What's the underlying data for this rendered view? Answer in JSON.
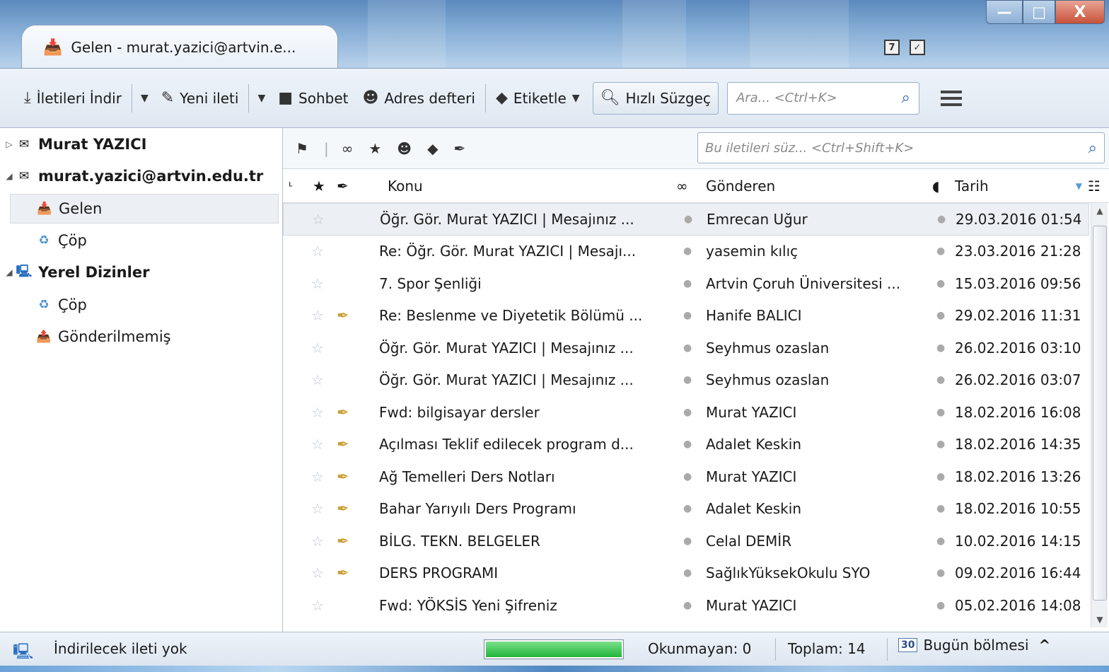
{
  "window": {
    "tab_title": "Gelen - murat.yazici@artvin.e...",
    "controls": {
      "minimize": "—",
      "maximize": "□",
      "close": "X"
    }
  },
  "toolbar": {
    "get_messages": "İletileri İndir",
    "new_message": "Yeni ileti",
    "chat": "Sohbet",
    "address_book": "Adres defteri",
    "tag": "Etiketle",
    "quick_filter": "Hızlı Süzgeç",
    "search_placeholder": "Ara... <Ctrl+K>"
  },
  "sidebar": {
    "items": [
      {
        "label": "Murat YAZICI",
        "bold": true,
        "icon": "mail-account-icon",
        "level": 0,
        "twisty": "▷"
      },
      {
        "label": "murat.yazici@artvin.edu.tr",
        "bold": true,
        "icon": "mail-account-icon",
        "level": 0,
        "twisty": "◢"
      },
      {
        "label": "Gelen",
        "bold": false,
        "icon": "inbox-icon",
        "level": 1,
        "selected": true
      },
      {
        "label": "Çöp",
        "bold": false,
        "icon": "trash-icon",
        "level": 1
      },
      {
        "label": "Yerel Dizinler",
        "bold": true,
        "icon": "local-folders-icon",
        "level": 0,
        "twisty": "◢"
      },
      {
        "label": "Çöp",
        "bold": false,
        "icon": "trash-icon",
        "level": 1
      },
      {
        "label": "Gönderilmemiş",
        "bold": false,
        "icon": "outbox-icon",
        "level": 1
      }
    ]
  },
  "quick_filter": {
    "search_placeholder": "Bu iletileri süz... <Ctrl+Shift+K>"
  },
  "columns": {
    "subject": "Konu",
    "sender": "Gönderen",
    "date": "Tarih"
  },
  "messages": [
    {
      "subject": "Öğr. Gör. Murat YAZICI | Mesajınız ...",
      "sender": "Emrecan Uğur",
      "date": "29.03.2016 01:54",
      "attachment": false,
      "selected": true
    },
    {
      "subject": "Re: Öğr. Gör. Murat YAZICI | Mesajı...",
      "sender": "yasemin kılıç",
      "date": "23.03.2016 21:28",
      "attachment": false
    },
    {
      "subject": "7. Spor Şenliği",
      "sender": "Artvin Çoruh Üniversitesi ...",
      "date": "15.03.2016 09:56",
      "attachment": false
    },
    {
      "subject": "Re: Beslenme ve Diyetetik Bölümü ...",
      "sender": "Hanife BALICI",
      "date": "29.02.2016 11:31",
      "attachment": true
    },
    {
      "subject": "Öğr. Gör. Murat YAZICI | Mesajınız ...",
      "sender": "Seyhmus ozaslan",
      "date": "26.02.2016 03:10",
      "attachment": false
    },
    {
      "subject": "Öğr. Gör. Murat YAZICI | Mesajınız ...",
      "sender": "Seyhmus ozaslan",
      "date": "26.02.2016 03:07",
      "attachment": false
    },
    {
      "subject": "Fwd: bilgisayar dersler",
      "sender": "Murat YAZICI",
      "date": "18.02.2016 16:08",
      "attachment": true
    },
    {
      "subject": "Açılması Teklif edilecek program d...",
      "sender": "Adalet Keskin",
      "date": "18.02.2016 14:35",
      "attachment": true
    },
    {
      "subject": "Ağ Temelleri Ders Notları",
      "sender": "Murat YAZICI",
      "date": "18.02.2016 13:26",
      "attachment": true
    },
    {
      "subject": "Bahar Yarıyılı Ders Programı",
      "sender": "Adalet Keskin",
      "date": "18.02.2016 10:55",
      "attachment": true
    },
    {
      "subject": "BİLG. TEKN. BELGELER",
      "sender": "Celal DEMİR",
      "date": "10.02.2016 14:15",
      "attachment": true
    },
    {
      "subject": "DERS PROGRAMI",
      "sender": "SağlıkYüksekOkulu SYO",
      "date": "09.02.2016 16:44",
      "attachment": true
    },
    {
      "subject": "Fwd: YÖKSİS Yeni Şifreniz",
      "sender": "Murat YAZICI",
      "date": "05.02.2016 14:08",
      "attachment": false
    }
  ],
  "status": {
    "message": "İndirilecek ileti yok",
    "progress": 1.0,
    "unread": "Okunmayan: 0",
    "total": "Toplam: 14",
    "today_pane": "Bugün bölmesi",
    "calendar_day": "30"
  }
}
